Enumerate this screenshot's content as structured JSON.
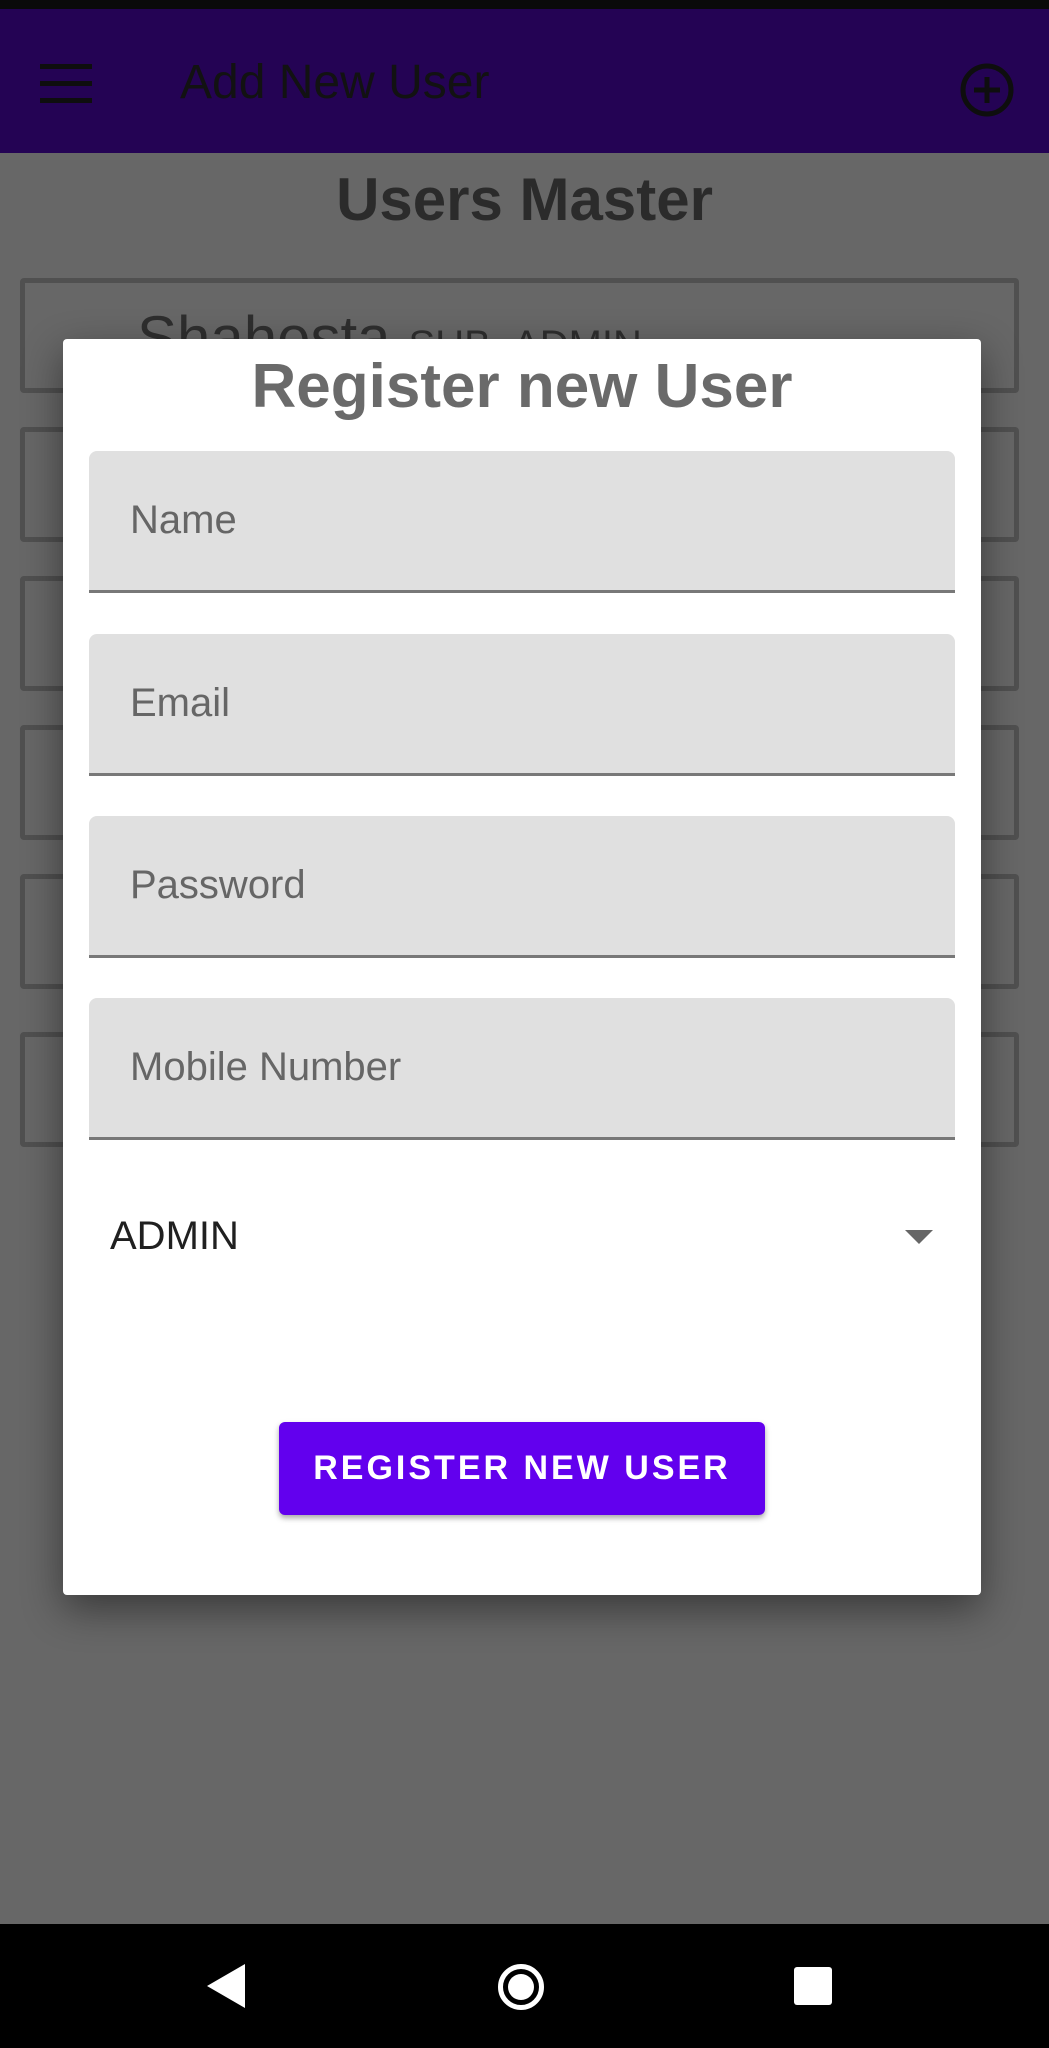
{
  "app_bar": {
    "title": "Add New User",
    "menu_icon": "hamburger-menu-icon",
    "add_icon": "circle-plus-icon",
    "color": "#240354"
  },
  "page": {
    "title": "Users Master",
    "rows": [
      {
        "name": "Shahesta",
        "role": "SUB_ADMIN"
      },
      {
        "name": "",
        "role": ""
      },
      {
        "name": "",
        "role": ""
      },
      {
        "name": "",
        "role": ""
      },
      {
        "name": "",
        "role": ""
      },
      {
        "name": "",
        "role": ""
      }
    ]
  },
  "dialog": {
    "title": "Register new User",
    "fields": {
      "name": {
        "placeholder": "Name",
        "value": ""
      },
      "email": {
        "placeholder": "Email",
        "value": ""
      },
      "password": {
        "placeholder": "Password",
        "value": ""
      },
      "mobile": {
        "placeholder": "Mobile Number",
        "value": ""
      }
    },
    "role_select": {
      "selected": "ADMIN"
    },
    "register_button": "REGISTER NEW USER",
    "accent": "#6200ee"
  },
  "nav_bar": {
    "back_icon": "back-triangle-icon",
    "home_icon": "home-circle-icon",
    "recents_icon": "recents-square-icon"
  }
}
